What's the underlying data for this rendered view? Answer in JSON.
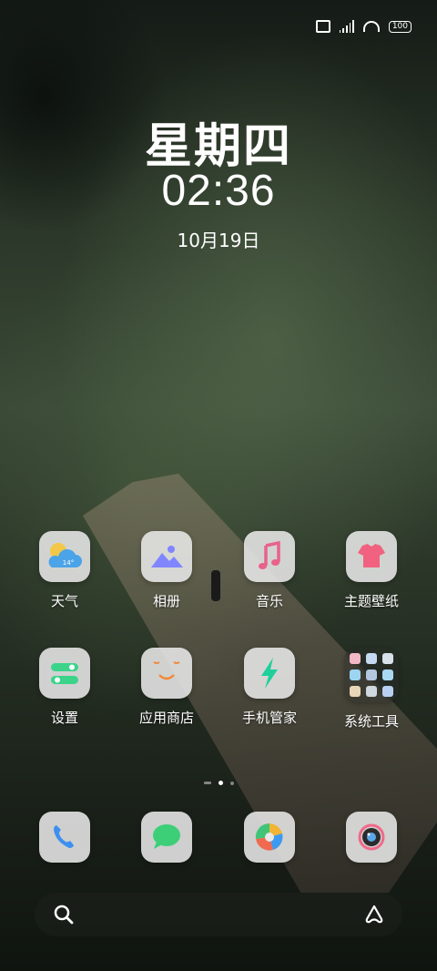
{
  "status_bar": {
    "battery": "100",
    "icons": [
      "vibrate-icon",
      "signal-icon",
      "wifi-icon",
      "battery-icon"
    ]
  },
  "clock": {
    "weekday": "星期四",
    "time": "02:36",
    "date": "10月19日"
  },
  "weather_widget": {
    "temp": "14°"
  },
  "apps_row1": [
    {
      "label": "天气",
      "icon": "weather-icon"
    },
    {
      "label": "相册",
      "icon": "gallery-icon"
    },
    {
      "label": "音乐",
      "icon": "music-icon"
    },
    {
      "label": "主题壁纸",
      "icon": "theme-icon"
    }
  ],
  "apps_row2": [
    {
      "label": "设置",
      "icon": "settings-icon"
    },
    {
      "label": "应用商店",
      "icon": "app-store-icon"
    },
    {
      "label": "手机管家",
      "icon": "phone-manager-icon"
    },
    {
      "label": "系统工具",
      "icon": "folder-icon"
    }
  ],
  "dock": [
    {
      "icon": "phone-icon"
    },
    {
      "icon": "messages-icon"
    },
    {
      "icon": "browser-icon"
    },
    {
      "icon": "camera-icon"
    }
  ],
  "page_indicator": {
    "pages": 3,
    "current": 2
  },
  "search_bar": {
    "left_icon": "search-icon",
    "right_icon": "assistant-icon"
  },
  "colors": {
    "tile_bg": "#e8e8e8",
    "music_pink": "#e8628a",
    "gallery_blue": "#7f86ff",
    "settings_green": "#3cd38a",
    "manager_teal": "#1fcf9c"
  }
}
